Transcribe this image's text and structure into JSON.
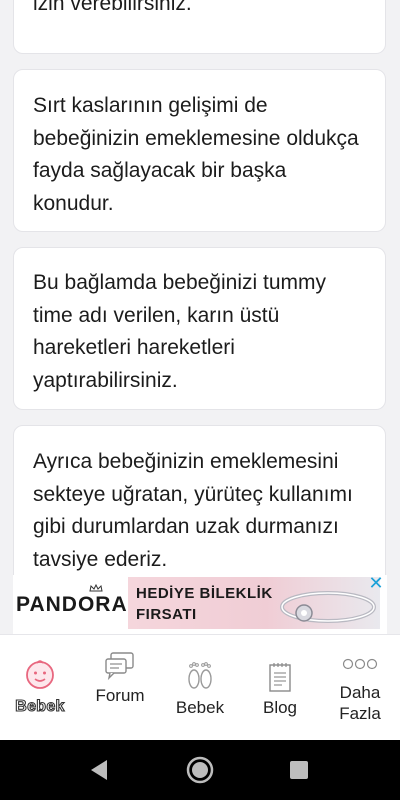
{
  "cards": [
    {
      "text": "izin verebilirsiniz."
    },
    {
      "text": "Sırt kaslarının gelişimi de bebeğinizin emeklemesine oldukça fayda sağlayacak bir başka konudur."
    },
    {
      "text": "Bu bağlamda bebeğinizi tummy time adı verilen, karın üstü hareketleri hareketleri yaptırabilirsiniz."
    },
    {
      "text": "Ayrıca bebeğinizin emeklemesini sekteye uğratan, yürüteç kullanımı gibi durumlardan uzak durmanızı tavsiye ederiz."
    }
  ],
  "ad": {
    "brand": "PANDORA",
    "headline": "HEDİYE BİLEKLİK FIRSATI",
    "close_icon": "close-icon",
    "accent": "#1aa0d8"
  },
  "tabs": [
    {
      "label": "Bebek",
      "icon": "baby-face-icon",
      "active": true,
      "color": "#e8677f"
    },
    {
      "label": "Forum",
      "icon": "chat-bubbles-icon"
    },
    {
      "label": "Bebek",
      "icon": "footprints-icon"
    },
    {
      "label": "Blog",
      "icon": "notepad-icon"
    },
    {
      "label": "Daha Fazla",
      "icon": "more-dots-icon"
    }
  ],
  "system_nav": [
    "back-icon",
    "home-icon",
    "recents-icon"
  ]
}
